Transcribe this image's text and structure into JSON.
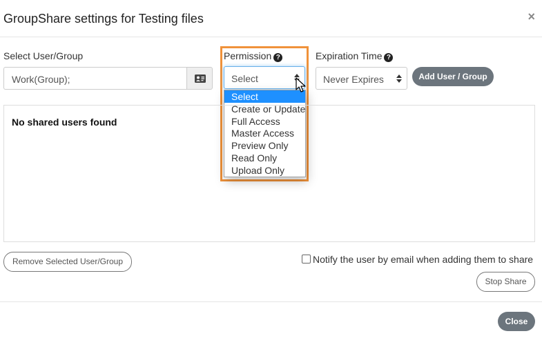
{
  "dialog": {
    "title": "GroupShare settings for Testing files",
    "close_symbol": "×"
  },
  "user_group": {
    "label": "Select User/Group",
    "value": "Work(Group);",
    "button_icon": "contact-card-icon"
  },
  "permission": {
    "label": "Permission",
    "help_icon": "question-circle-icon",
    "selected": "Select",
    "options": [
      "Select",
      "Create or Update",
      "Full Access",
      "Master Access",
      "Preview Only",
      "Read Only",
      "Upload Only"
    ],
    "highlight_color": "#f0923a"
  },
  "expiration": {
    "label": "Expiration Time",
    "help_icon": "question-circle-icon",
    "selected": "Never Expires"
  },
  "add_button": {
    "label": "Add User / Group"
  },
  "shared_list": {
    "empty_message": "No shared users found"
  },
  "remove_button": {
    "label": "Remove Selected User/Group"
  },
  "notify": {
    "label": "Notify the user by email when adding them to share",
    "checked": false
  },
  "stop_button": {
    "label": "Stop Share"
  },
  "close_button": {
    "label": "Close"
  },
  "colors": {
    "accent_dark_button": "#6c757d",
    "option_selected": "#1e90ff"
  }
}
